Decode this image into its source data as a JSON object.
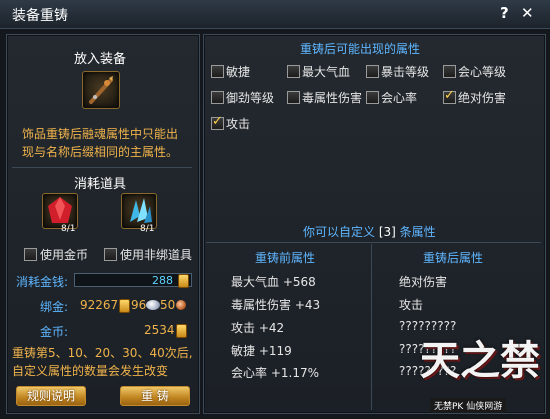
{
  "window": {
    "title": "装备重铸",
    "help_icon": "?",
    "close_icon": "✕"
  },
  "left": {
    "put_title": "放入装备",
    "desc": [
      "饰品重铸后融魂属性中只能出",
      "现与名称后缀相同的主属性。"
    ],
    "consume_title": "消耗道具",
    "item1_count": "8/1",
    "item2_count": "8/1",
    "use_gold_label": "使用金币",
    "use_unbound_label": "使用非绑道具",
    "cost_label": "消耗金钱:",
    "cost_value": "288",
    "bound_label": "绑金:",
    "bound_gold": "92267",
    "bound_silver": "96",
    "bound_copper": "50",
    "gold_label": "金币:",
    "gold_value": "2534",
    "notice": [
      "重铸第5、10、20、30、40次后,",
      "自定义属性的数量会发生改变"
    ],
    "rules_button": "规则说明",
    "recast_button": "重  铸"
  },
  "right": {
    "possible_title": "重铸后可能出现的属性",
    "attributes": [
      {
        "label": "敏捷",
        "checked": false
      },
      {
        "label": "最大气血",
        "checked": false
      },
      {
        "label": "暴击等级",
        "checked": false
      },
      {
        "label": "会心等级",
        "checked": false
      },
      {
        "label": "御劲等级",
        "checked": false
      },
      {
        "label": "毒属性伤害",
        "checked": false
      },
      {
        "label": "会心率",
        "checked": false
      },
      {
        "label": "绝对伤害",
        "checked": true
      },
      {
        "label": "攻击",
        "checked": true
      }
    ],
    "custom_prefix": "你可以自定义 ",
    "custom_count": "[3]",
    "custom_suffix": " 条属性",
    "before_title": "重铸前属性",
    "after_title": "重铸后属性",
    "before_list": [
      "最大气血 +568",
      "毒属性伤害 +43",
      "攻击 +42",
      "敏捷 +119",
      "会心率 +1.17%"
    ],
    "after_list": [
      "绝对伤害",
      "攻击",
      "?????????",
      "?????????",
      "?????????"
    ]
  },
  "logo": {
    "main": "天之禁",
    "sub": "无禁PK 仙侠网游"
  }
}
